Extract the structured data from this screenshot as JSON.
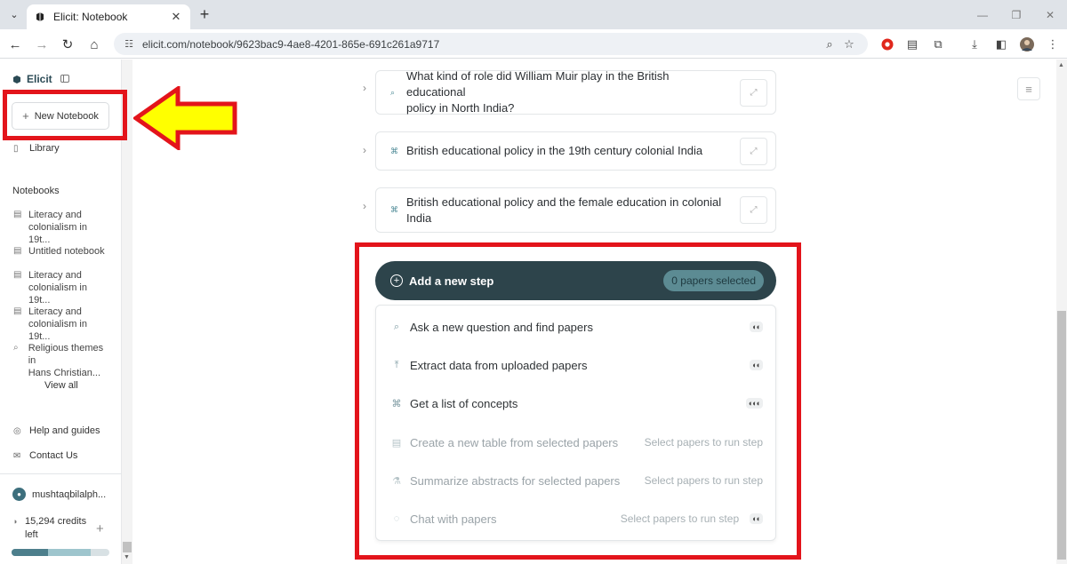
{
  "browser": {
    "tab_title": "Elicit: Notebook",
    "url": "elicit.com/notebook/9623bac9-4ae8-4201-865e-691c261a9717",
    "new_tab_symbol": "+",
    "tab_close_symbol": "✕"
  },
  "sidebar": {
    "brand": "Elicit",
    "new_notebook": "New Notebook",
    "library": "Library",
    "notebooks_heading": "Notebooks",
    "notebooks": [
      {
        "line1": "Literacy and",
        "line2": "colonialism in 19t..."
      },
      {
        "line1": "Untitled notebook",
        "line2": ""
      },
      {
        "line1": "Literacy and",
        "line2": "colonialism in 19t..."
      },
      {
        "line1": "Literacy and",
        "line2": "colonialism in 19t..."
      },
      {
        "line1": "Religious themes in",
        "line2": "Hans Christian..."
      }
    ],
    "view_all": "View all",
    "help": "Help and guides",
    "contact": "Contact Us",
    "user": "mushtaqbilalph...",
    "credits_line1": "15,294 credits",
    "credits_line2": "left",
    "credits_used_fraction": 0.37,
    "credits_secondary_fraction": 0.81
  },
  "main": {
    "steps": [
      {
        "line1": "What kind of role did William Muir play in the British educational",
        "line2": "policy in North India?",
        "icon": "search-icon"
      },
      {
        "line1": "British educational policy in the 19th century colonial India",
        "line2": "",
        "icon": "concepts-icon"
      },
      {
        "line1": "British educational policy and the female education in colonial",
        "line2": "India",
        "icon": "concepts-icon"
      }
    ],
    "add_step": "Add a new step",
    "papers_selected": "0 papers selected",
    "options": [
      {
        "label": "Ask a new question and find papers",
        "hint": "",
        "badge": "◐◐",
        "disabled": false
      },
      {
        "label": "Extract data from uploaded papers",
        "hint": "",
        "badge": "◐◐",
        "disabled": false
      },
      {
        "label": "Get a list of concepts",
        "hint": "",
        "badge": "◐◐◐",
        "disabled": false
      },
      {
        "label": "Create a new table from selected papers",
        "hint": "Select papers to run step",
        "badge": "",
        "disabled": true
      },
      {
        "label": "Summarize abstracts for selected papers",
        "hint": "Select papers to run step",
        "badge": "",
        "disabled": true
      },
      {
        "label": "Chat with papers",
        "hint": "Select papers to run step",
        "badge": "◐◐",
        "disabled": true
      }
    ]
  },
  "colors": {
    "annotation_red": "#e3141b",
    "arrow_yellow": "#ffff00",
    "add_step_bg": "#2d444b",
    "pill_bg": "#5c8b93"
  }
}
